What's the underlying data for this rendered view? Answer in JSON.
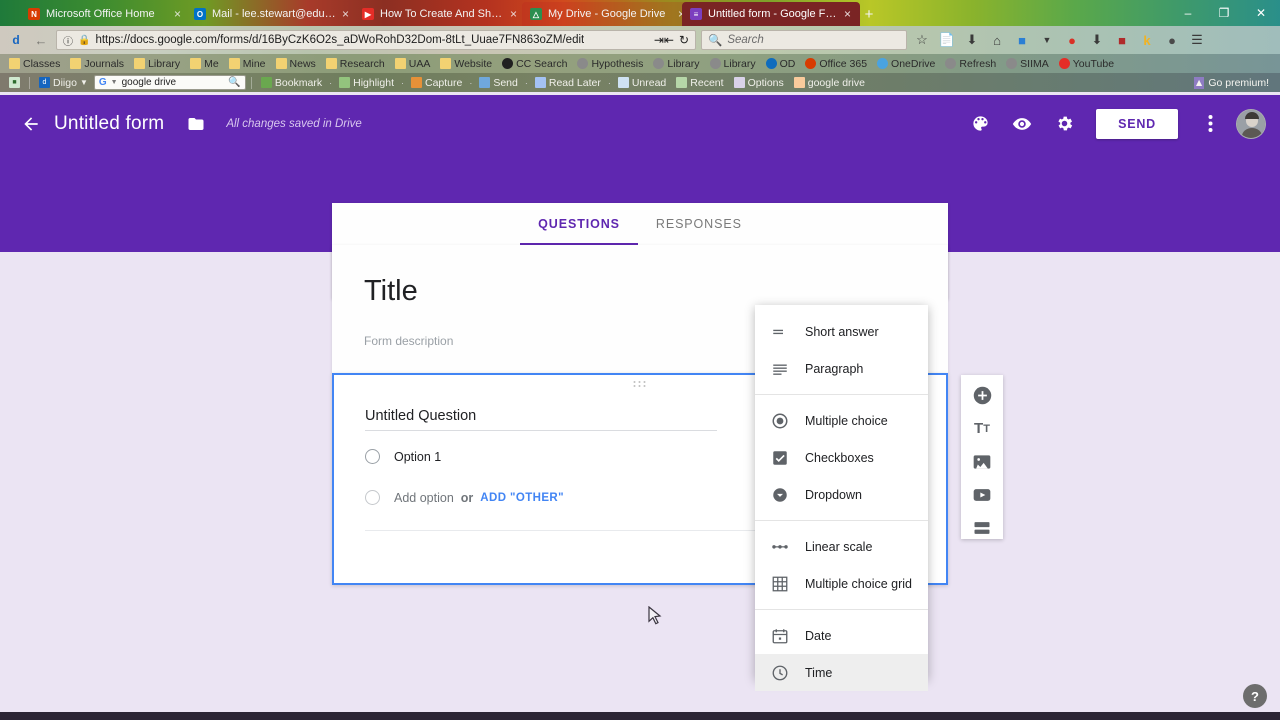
{
  "browser": {
    "tabs": [
      {
        "label": "Microsoft Office Home",
        "favicon": "office-icon",
        "favicon_color": "#d83b01",
        "favicon_text": "N"
      },
      {
        "label": "Mail - lee.stewart@edu.ua...",
        "favicon": "outlook-icon",
        "favicon_color": "#0072c6",
        "favicon_text": "O"
      },
      {
        "label": "How To Create And Share ...",
        "favicon": "youtube-icon",
        "favicon_color": "#e52d27",
        "favicon_text": "▶"
      },
      {
        "label": "My Drive - Google Drive",
        "favicon": "drive-icon",
        "favicon_color": "#f4b400",
        "favicon_text": "△"
      },
      {
        "label": "Untitled form - Google Fo...",
        "favicon": "forms-icon",
        "favicon_color": "#7b3fbf",
        "favicon_text": "≡"
      }
    ],
    "new_tab_label": "+",
    "close_label": "×",
    "window_controls": {
      "minimize": "–",
      "maximize": "❐",
      "close": "✕"
    },
    "nav": {
      "back": "←",
      "forward": "→",
      "info_icon": "info-icon",
      "lock_icon": "lock-icon",
      "url": "https://docs.google.com/forms/d/16ByCzK6O2s_aDWoRohD32Dom-8tLt_Uuae7FN863oZM/edit",
      "url_domain": "google.com",
      "translate_icon": "translate-icon",
      "reload_icon": "reload-icon"
    },
    "search": {
      "placeholder": "Search",
      "icon": "search-icon"
    },
    "toolbar_icons": [
      {
        "name": "star-icon",
        "glyph": "☆"
      },
      {
        "name": "reading-list-icon",
        "glyph": "὜8"
      },
      {
        "name": "download-icon",
        "glyph": "⬇"
      },
      {
        "name": "home-icon",
        "glyph": "⌂"
      },
      {
        "name": "pocket-icon",
        "glyph": "◆"
      },
      {
        "name": "chevron-down-icon",
        "glyph": "ˇ"
      },
      {
        "name": "extension-colors-icon",
        "glyph": "●"
      },
      {
        "name": "downthemall-icon",
        "glyph": "⬇"
      },
      {
        "name": "adblock-icon",
        "glyph": "■"
      },
      {
        "name": "kami-icon",
        "glyph": "k"
      },
      {
        "name": "evernote-icon",
        "glyph": "●"
      },
      {
        "name": "menu-icon",
        "glyph": "☰"
      }
    ],
    "bookmarks_row1": [
      {
        "label": "Classes",
        "icon": "folder-icon"
      },
      {
        "label": "Journals",
        "icon": "folder-icon"
      },
      {
        "label": "Library",
        "icon": "folder-icon"
      },
      {
        "label": "Me",
        "icon": "folder-icon"
      },
      {
        "label": "Mine",
        "icon": "folder-icon"
      },
      {
        "label": "News",
        "icon": "folder-icon"
      },
      {
        "label": "Research",
        "icon": "folder-icon"
      },
      {
        "label": "UAA",
        "icon": "folder-icon"
      },
      {
        "label": "Website",
        "icon": "folder-icon"
      },
      {
        "label": "CC Search",
        "icon": "creativecommons-icon",
        "color": "#202020"
      },
      {
        "label": "Hypothesis",
        "icon": "globe-icon",
        "color": "#8a8a8a"
      },
      {
        "label": "Library",
        "icon": "globe-icon",
        "color": "#8a8a8a"
      },
      {
        "label": "Library",
        "icon": "globe-icon",
        "color": "#8a8a8a"
      },
      {
        "label": "OD",
        "icon": "onedrive-icon",
        "color": "#0f6cbd"
      },
      {
        "label": "Office 365",
        "icon": "office-icon",
        "color": "#d83b01"
      },
      {
        "label": "OneDrive",
        "icon": "cloud-icon",
        "color": "#4aa3e0"
      },
      {
        "label": "Refresh",
        "icon": "globe-icon",
        "color": "#8a8a8a"
      },
      {
        "label": "SIIMA",
        "icon": "globe-icon",
        "color": "#8a8a8a"
      },
      {
        "label": "YouTube",
        "icon": "youtube-icon",
        "color": "#e52d27"
      }
    ],
    "bookmarks_row2": {
      "diigo_label": "Diigo",
      "diigo_icon": "diigo-icon",
      "app-icon": "extension-icon",
      "google_icon": "google-icon",
      "search_query": "google drive",
      "search_icon": "search-icon",
      "items": [
        {
          "label": "Bookmark",
          "icon": "bookmark-icon"
        },
        {
          "label": "Highlight",
          "icon": "highlight-icon"
        },
        {
          "label": "Capture",
          "icon": "capture-icon"
        },
        {
          "label": "Send",
          "icon": "send-icon"
        },
        {
          "label": "Read Later",
          "icon": "readlater-icon"
        },
        {
          "label": "Unread",
          "icon": "unread-icon"
        },
        {
          "label": "Recent",
          "icon": "recent-icon"
        },
        {
          "label": "Options",
          "icon": "options-icon"
        },
        {
          "label": "google  drive",
          "icon": "pencil-icon"
        }
      ],
      "go_premium": "Go premium!",
      "go_premium_icon": "premium-icon"
    }
  },
  "forms": {
    "back_icon": "back-arrow-icon",
    "title": "Untitled form",
    "folder_icon": "folder-icon",
    "saved_status": "All changes saved in Drive",
    "header_actions": [
      {
        "name": "theme-palette-icon",
        "label": "Change theme"
      },
      {
        "name": "preview-eye-icon",
        "label": "Preview"
      },
      {
        "name": "settings-gear-icon",
        "label": "Settings"
      }
    ],
    "send_label": "SEND",
    "more_icon": "more-vertical-icon",
    "avatar": "account-avatar",
    "tabs": [
      {
        "label": "QUESTIONS",
        "selected": true
      },
      {
        "label": "RESPONSES",
        "selected": false
      }
    ],
    "form_title": "Title",
    "form_description": "Form description",
    "question": {
      "drag_handle": "drag-handle-icon",
      "title": "Untitled Question",
      "image_icon": "add-image-icon",
      "option1": "Option 1",
      "add_option": "Add option",
      "or": "or",
      "add_other": "ADD \"OTHER\"",
      "duplicate_icon": "duplicate-icon"
    },
    "side_toolbar": [
      {
        "name": "add-question-icon",
        "label": "Add question"
      },
      {
        "name": "add-title-icon",
        "label": "Add title and description"
      },
      {
        "name": "add-image-icon",
        "label": "Add image"
      },
      {
        "name": "add-video-icon",
        "label": "Add video"
      },
      {
        "name": "add-section-icon",
        "label": "Add section"
      }
    ],
    "type_menu": {
      "groups": [
        [
          {
            "label": "Short answer",
            "icon": "short-answer-icon",
            "hovered": false
          },
          {
            "label": "Paragraph",
            "icon": "paragraph-icon",
            "hovered": false
          }
        ],
        [
          {
            "label": "Multiple choice",
            "icon": "radio-button-icon",
            "hovered": false
          },
          {
            "label": "Checkboxes",
            "icon": "checkbox-icon",
            "hovered": false
          },
          {
            "label": "Dropdown",
            "icon": "dropdown-icon",
            "hovered": false
          }
        ],
        [
          {
            "label": "Linear scale",
            "icon": "linear-scale-icon",
            "hovered": false
          },
          {
            "label": "Multiple choice grid",
            "icon": "grid-icon",
            "hovered": false
          }
        ],
        [
          {
            "label": "Date",
            "icon": "calendar-icon",
            "hovered": false
          },
          {
            "label": "Time",
            "icon": "clock-icon",
            "hovered": true
          }
        ]
      ]
    },
    "help_label": "?"
  },
  "colors": {
    "purple": "#5f27b0",
    "page_bg": "#EBE4F3",
    "accent_blue": "#4285f4",
    "card_white": "#ffffff"
  }
}
